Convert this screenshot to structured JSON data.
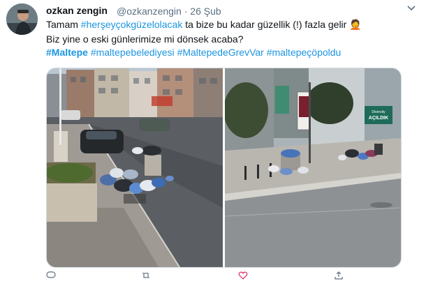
{
  "tweet": {
    "display_name": "ozkan zengin",
    "handle": "@ozkanzengin",
    "separator": "·",
    "date": "26 Şub",
    "line1_pre": "Tamam ",
    "line1_tag": "#herşeyçokgüzelolacak",
    "line1_post": " ta bize bu kadar güzellik (!) fazla gelir",
    "line1_emoji": "🤦",
    "line2": "Biz yine o eski günlerimize mi dönsek acaba?",
    "hashtags": [
      "#Maltepe",
      "#maltepebelediyesi",
      "#MaltepedeGrevVar",
      "#maltepeçöpoldu"
    ]
  },
  "photo2": {
    "banner_text": "AÇILDIK",
    "banner_sub": "Diversity"
  },
  "icons": {
    "caret": "chevron-down-icon",
    "reply": "reply-icon",
    "retweet": "retweet-icon",
    "like": "like-icon",
    "share": "share-icon"
  },
  "colors": {
    "link": "#1b95e0",
    "text": "#0f1419",
    "muted": "#5b7083"
  }
}
